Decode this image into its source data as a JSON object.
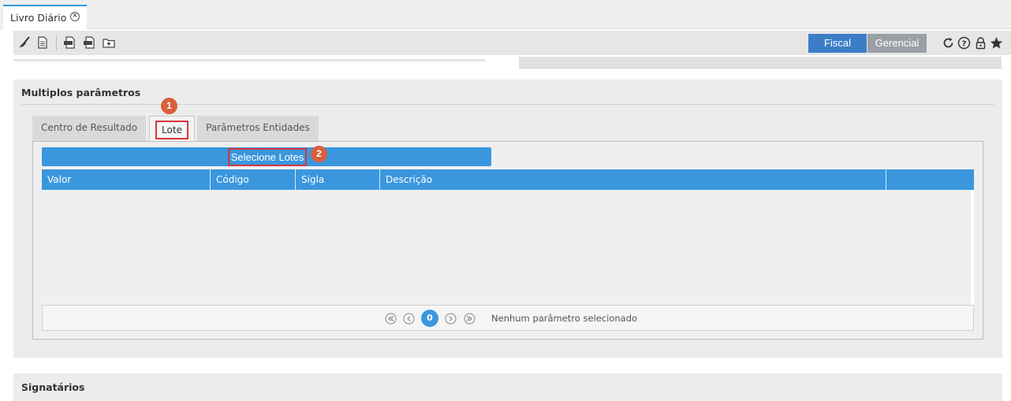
{
  "tab": {
    "title": "Livro Diário",
    "close_icon": "close-circle-icon"
  },
  "toolbar": {
    "left_icons": [
      "broom-icon",
      "document-icon",
      "pdf-export-icon",
      "xls-export-icon",
      "folder-upload-icon"
    ],
    "fiscal_label": "Fiscal",
    "gerencial_label": "Gerencial",
    "right_icons": [
      "refresh-icon",
      "help-icon",
      "lock-icon",
      "star-icon"
    ],
    "active_color": "#3d7dc8",
    "inactive_color": "#9aa0a6"
  },
  "panel": {
    "title": "Multiplos parâmetros",
    "tabs": [
      {
        "label": "Centro de Resultado"
      },
      {
        "label": "Lote"
      },
      {
        "label": "Parâmetros Entidades"
      }
    ],
    "select_button": "Selecione Lotes",
    "columns": [
      "Valor",
      "Código",
      "Sigla",
      "Descrição"
    ],
    "pager": {
      "current_page": "0",
      "status": "Nenhum parâmetro selecionado"
    },
    "accent": "#3a97dd"
  },
  "badges": {
    "tab_badge": "1",
    "button_badge": "2",
    "color": "#d9603b"
  },
  "panel2": {
    "title": "Signatários"
  }
}
